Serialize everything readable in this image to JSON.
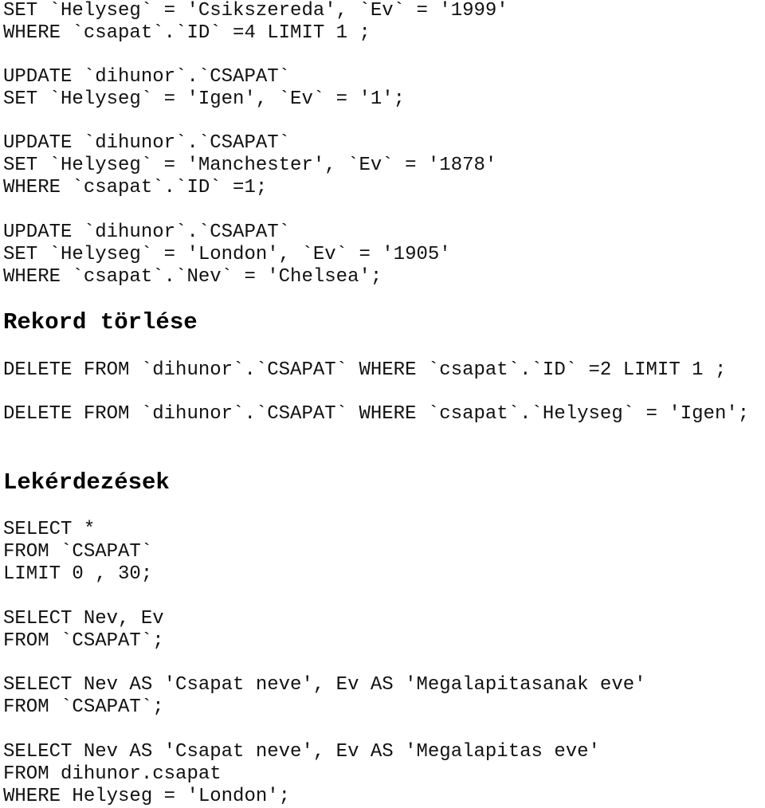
{
  "update_block": [
    "SET `Helyseg` = 'Csikszereda', `Ev` = '1999'",
    "WHERE `csapat`.`ID` =4 LIMIT 1 ;",
    "UPDATE `dihunor`.`CSAPAT`",
    "SET `Helyseg` = 'Igen', `Ev` = '1';",
    "UPDATE `dihunor`.`CSAPAT`",
    "SET `Helyseg` = 'Manchester', `Ev` = '1878'",
    "WHERE `csapat`.`ID` =1;",
    "UPDATE `dihunor`.`CSAPAT`",
    "SET `Helyseg` = 'London', `Ev` = '1905'",
    "WHERE `csapat`.`Nev` = 'Chelsea';"
  ],
  "delete_section": {
    "heading": "Rekord törlése",
    "lines": [
      "DELETE FROM `dihunor`.`CSAPAT` WHERE `csapat`.`ID` =2 LIMIT 1 ;",
      "DELETE FROM `dihunor`.`CSAPAT` WHERE `csapat`.`Helyseg` = 'Igen';"
    ]
  },
  "query_section": {
    "heading": "Lekérdezések",
    "lines": [
      "SELECT *",
      "FROM `CSAPAT`",
      "LIMIT 0 , 30;",
      "SELECT Nev, Ev",
      "FROM `CSAPAT`;",
      "SELECT Nev AS 'Csapat neve', Ev AS 'Megalapitasanak eve'",
      "FROM `CSAPAT`;",
      "SELECT Nev AS 'Csapat neve', Ev AS 'Megalapitas eve'",
      "FROM dihunor.csapat",
      "WHERE Helyseg = 'London';"
    ]
  }
}
